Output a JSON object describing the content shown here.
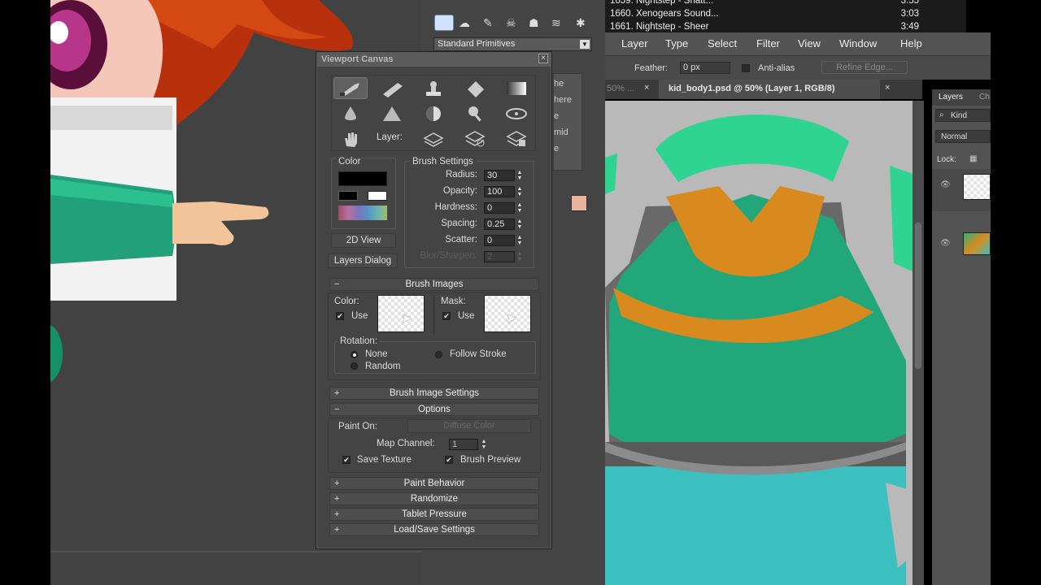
{
  "max_panel": {
    "dropdown_value": "Standard Primitives",
    "partial_buttons": [
      "he",
      "here",
      "e",
      "mid",
      "e"
    ]
  },
  "media_list": {
    "rows": [
      {
        "title": "1659. Nightstep - Shatt...",
        "duration": "3:55"
      },
      {
        "title": "1660. Xenogears Sound...",
        "duration": "3:03"
      },
      {
        "title": "1661. Nightstep - Sheer",
        "duration": "3:49"
      }
    ]
  },
  "photoshop": {
    "menu": [
      "Layer",
      "Type",
      "Select",
      "Filter",
      "View",
      "Window",
      "Help"
    ],
    "options": {
      "feather_label": "Feather:",
      "feather_value": "0 px",
      "anti_alias_label": "Anti-alias",
      "refine_edge_label": "Refine Edge..."
    },
    "tabs": [
      {
        "label": "50% ..."
      },
      {
        "label": "kid_body1.psd @ 50% (Layer 1, RGB/8)"
      }
    ],
    "layers_panel": {
      "tab_label": "Layers",
      "tab2_label": "Ch",
      "kind_label": "Kind",
      "blend_mode": "Normal",
      "lock_label": "Lock:"
    }
  },
  "dialog": {
    "title": "Viewport Canvas",
    "layer_label": "Layer:",
    "color_section_label": "Color",
    "view_2d_button": "2D View",
    "layers_dialog_button": "Layers Dialog",
    "brush_settings": {
      "title": "Brush Settings",
      "fields": [
        {
          "label": "Radius:",
          "value": "30"
        },
        {
          "label": "Opacity:",
          "value": "100"
        },
        {
          "label": "Hardness:",
          "value": "0"
        },
        {
          "label": "Spacing:",
          "value": "0.25"
        },
        {
          "label": "Scatter:",
          "value": "0"
        },
        {
          "label": "Blur/Sharpen:",
          "value": "2"
        }
      ]
    },
    "brush_images": {
      "title": "Brush Images",
      "color_label": "Color:",
      "mask_label": "Mask:",
      "use_label": "Use",
      "rotation_label": "Rotation:",
      "rotation_none": "None",
      "rotation_follow": "Follow Stroke",
      "rotation_random": "Random"
    },
    "brush_image_settings": "Brush Image Settings",
    "options": {
      "title": "Options",
      "paint_on_label": "Paint On:",
      "paint_on_value": "Diffuse Color",
      "map_channel_label": "Map Channel:",
      "map_channel_value": "1",
      "save_texture_label": "Save Texture",
      "brush_preview_label": "Brush Preview"
    },
    "paint_behavior": "Paint Behavior",
    "randomize": "Randomize",
    "tablet_pressure": "Tablet Pressure",
    "load_save_settings": "Load/Save Settings",
    "colors": {
      "primary": "#000000",
      "swatch_black": "#000000",
      "swatch_white": "#ffffff"
    }
  },
  "colors": {
    "green": "#22a77a",
    "orange": "#d88a1e",
    "teal": "#3bbfbf",
    "mint": "#2fd392"
  }
}
